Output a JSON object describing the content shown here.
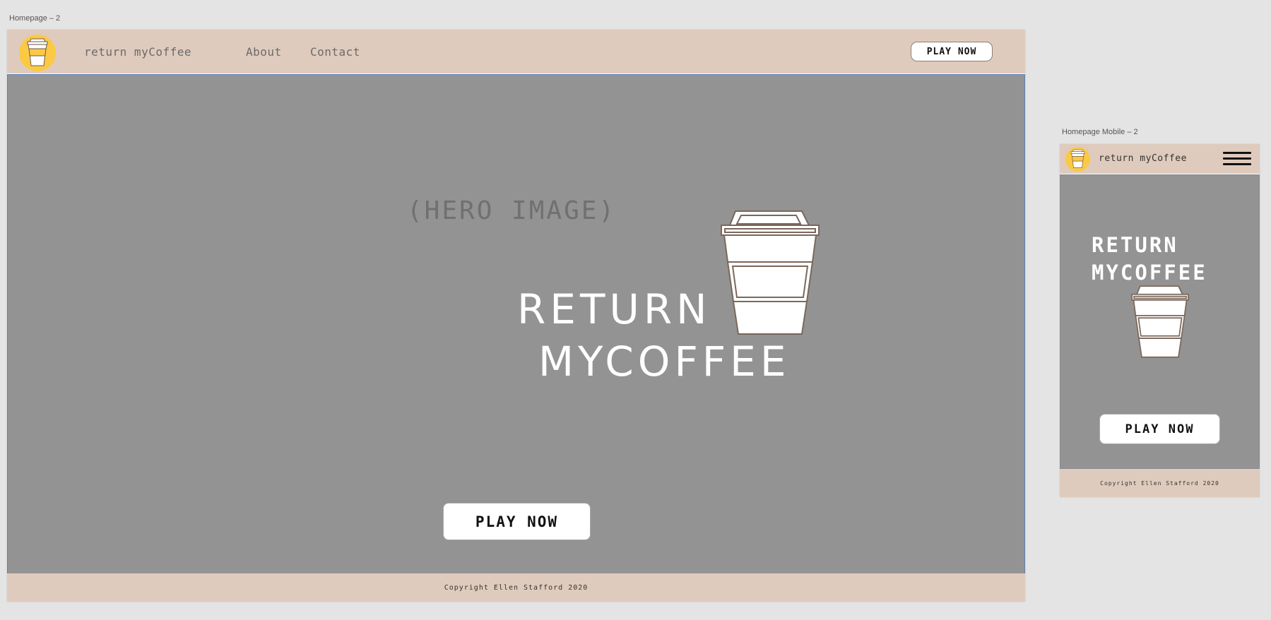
{
  "artboards": {
    "desktop_label": "Homepage – 2",
    "mobile_label": "Homepage Mobile – 2"
  },
  "desktop": {
    "brand": "return myCoffee",
    "nav": {
      "about": "About",
      "contact": "Contact"
    },
    "header_cta": "PLAY NOW",
    "hero_placeholder": "(HERO IMAGE)",
    "hero_title_line1": "RETURN",
    "hero_title_line2": "MYCOFFEE",
    "hero_cta": "PLAY NOW",
    "footer": "Copyright Ellen Stafford 2020"
  },
  "mobile": {
    "brand": "return myCoffee",
    "hero_title_line1": "RETURN",
    "hero_title_line2": "MYCOFFEE",
    "hero_cta": "PLAY NOW",
    "footer": "Copyright Ellen Stafford 2020"
  },
  "colors": {
    "header_bg": "#dfcbbd",
    "hero_bg": "#939393",
    "logo_yellow": "#fbc944",
    "canvas_bg": "#e4e4e4"
  },
  "icons": {
    "logo": "coffee-cup-icon",
    "hero": "coffee-cup-icon",
    "menu": "hamburger-menu-icon"
  }
}
